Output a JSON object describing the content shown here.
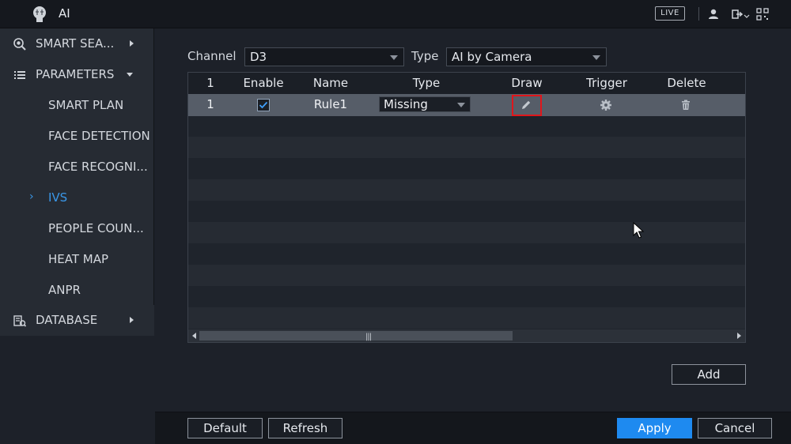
{
  "window": {
    "title": "AI",
    "live_label": "LIVE"
  },
  "sidebar": {
    "items": [
      {
        "label": "SMART SEA...",
        "icon": "smart-search-icon",
        "expandable": true
      },
      {
        "label": "PARAMETERS",
        "icon": "list-icon",
        "expanded": true
      },
      {
        "label": "DATABASE",
        "icon": "database-icon",
        "expandable": true
      }
    ],
    "parameters_sub": [
      {
        "label": "SMART PLAN",
        "active": false
      },
      {
        "label": "FACE DETECTION",
        "active": false
      },
      {
        "label": "FACE RECOGNI...",
        "active": false
      },
      {
        "label": "IVS",
        "active": true
      },
      {
        "label": "PEOPLE COUN...",
        "active": false
      },
      {
        "label": "HEAT MAP",
        "active": false
      },
      {
        "label": "ANPR",
        "active": false
      }
    ]
  },
  "filters": {
    "channel_label": "Channel",
    "channel_value": "D3",
    "type_label": "Type",
    "type_value": "AI by Camera"
  },
  "table": {
    "headers": [
      "1",
      "Enable",
      "Name",
      "Type",
      "Draw",
      "Trigger",
      "Delete"
    ],
    "rows": [
      {
        "index": "1",
        "enabled": true,
        "name": "Rule1",
        "type": "Missing",
        "draw_icon": "pencil-icon",
        "trigger_icon": "gear-icon",
        "delete_icon": "trash-icon"
      }
    ]
  },
  "buttons": {
    "add": "Add",
    "default": "Default",
    "refresh": "Refresh",
    "apply": "Apply",
    "cancel": "Cancel"
  },
  "colors": {
    "accent": "#1e8af0",
    "active_nav": "#3a97e8",
    "highlight_box": "#e0161b"
  }
}
